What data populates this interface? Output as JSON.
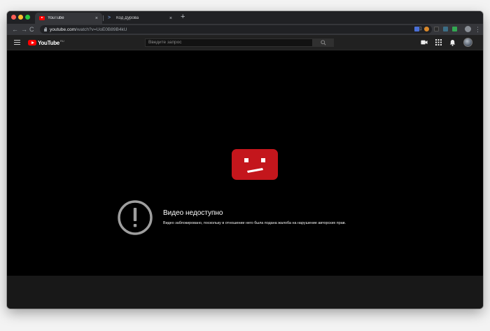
{
  "browser": {
    "tabs": [
      {
        "title": "YouTube",
        "active": true,
        "favicon": "youtube-favicon",
        "close": "×"
      },
      {
        "title": "Код Дурова",
        "active": false,
        "favicon": "kod-durova-favicon",
        "close": "×"
      }
    ],
    "new_tab": "+",
    "nav": {
      "back": "←",
      "forward": "→",
      "reload": "C"
    },
    "url_host": "youtube.com",
    "url_path": "/watch?v=UoE0B89B4kU",
    "omnibox_icons": "⊡ ☆",
    "menu": "⋮"
  },
  "youtube": {
    "logo_text": "YouTube",
    "logo_superscript": "RU",
    "search_placeholder": "Введите запрос"
  },
  "error": {
    "icon": "exclamation",
    "title": "Видео недоступно",
    "description": "Видео заблокировано, поскольку в отношении него была подана жалоба на нарушение авторских прав."
  },
  "colors": {
    "youtube_red": "#ff0000",
    "sad_tv_red": "#c4161c",
    "player_bg": "#000000",
    "masthead_bg": "#212121"
  }
}
